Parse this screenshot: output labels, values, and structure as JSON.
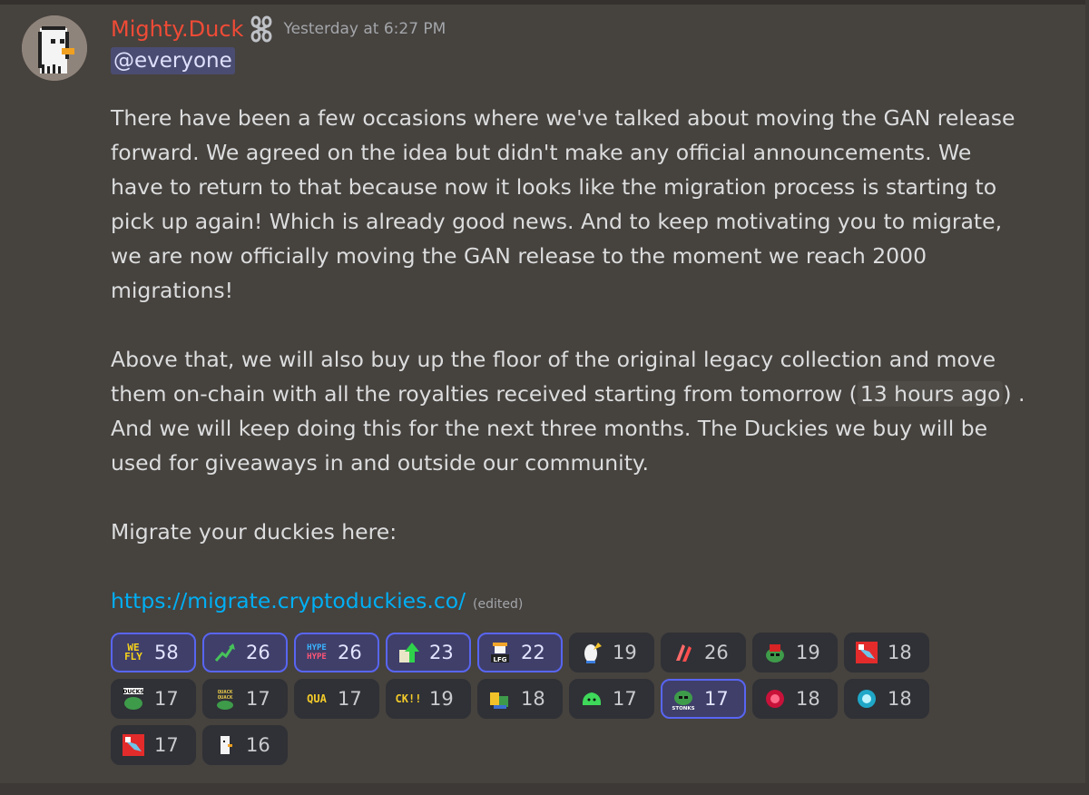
{
  "message": {
    "author": "Mighty.Duck",
    "badge_icon": "chain-link-icon",
    "timestamp": "Yesterday at 6:27 PM",
    "mention": "@everyone",
    "paragraph1": "There have been a few occasions where we've talked about moving the GAN release forward. We agreed on the idea but didn't make any official announcements. We have to return to that because now it looks like the migration process is starting to pick up again! Which is already good news. And to keep motivating you to migrate, we are now officially moving the GAN release to the moment we reach 2000 migrations!",
    "paragraph2_before": "Above that, we will also buy up the floor of the original legacy collection and move them on-chain with all the royalties received starting from tomorrow (",
    "paragraph2_time": "13 hours ago",
    "paragraph2_after": ") . And we will keep doing this for the next three months. The Duckies we buy will be used for giveaways in and outside our community.",
    "paragraph3": "Migrate your duckies here:",
    "link": "https://migrate.cryptoduckies.co/",
    "edited": "(edited)"
  },
  "reactions": [
    {
      "emoji": "we-fly-emoji",
      "text": "WE FLY",
      "count": "58",
      "active": true
    },
    {
      "emoji": "chart-arrow-emoji",
      "count": "26",
      "active": true
    },
    {
      "emoji": "hype-hype-emoji",
      "text": "HYPE HYPE",
      "count": "26",
      "active": true
    },
    {
      "emoji": "green-arrow-up-emoji",
      "count": "23",
      "active": true
    },
    {
      "emoji": "lfg-duck-emoji",
      "text": "LFG",
      "count": "22",
      "active": true
    },
    {
      "emoji": "rocket-duck-emoji",
      "count": "19",
      "active": false
    },
    {
      "emoji": "red-hands-emoji",
      "count": "26",
      "active": false
    },
    {
      "emoji": "pepe-mask-emoji",
      "count": "19",
      "active": false
    },
    {
      "emoji": "red-duck-emoji",
      "count": "18",
      "active": false
    },
    {
      "emoji": "ducks-pepe-emoji",
      "text": "DUCKS",
      "count": "17",
      "active": false
    },
    {
      "emoji": "quack-quack-emoji",
      "text": "QUACK QUACK",
      "count": "17",
      "active": false
    },
    {
      "emoji": "qua-emoji",
      "text": "QUA",
      "count": "17",
      "active": false
    },
    {
      "emoji": "ck-emoji",
      "text": "CK!!",
      "count": "19",
      "active": false
    },
    {
      "emoji": "duck-dance-emoji",
      "count": "18",
      "active": false
    },
    {
      "emoji": "green-blob-emoji",
      "count": "17",
      "active": false
    },
    {
      "emoji": "stonks-pepe-emoji",
      "text": "STONKS",
      "count": "17",
      "active": true
    },
    {
      "emoji": "red-orb-emoji",
      "count": "18",
      "active": false
    },
    {
      "emoji": "blue-orb-emoji",
      "count": "18",
      "active": false
    },
    {
      "emoji": "red-duck-emoji",
      "count": "17",
      "active": false
    },
    {
      "emoji": "white-duck-emoji",
      "count": "16",
      "active": false
    }
  ],
  "colors": {
    "background": "#46423e",
    "username": "#f04b36",
    "link": "#00aff4",
    "mention_bg": "#4b4c72",
    "reaction_active_border": "#5865f2"
  }
}
